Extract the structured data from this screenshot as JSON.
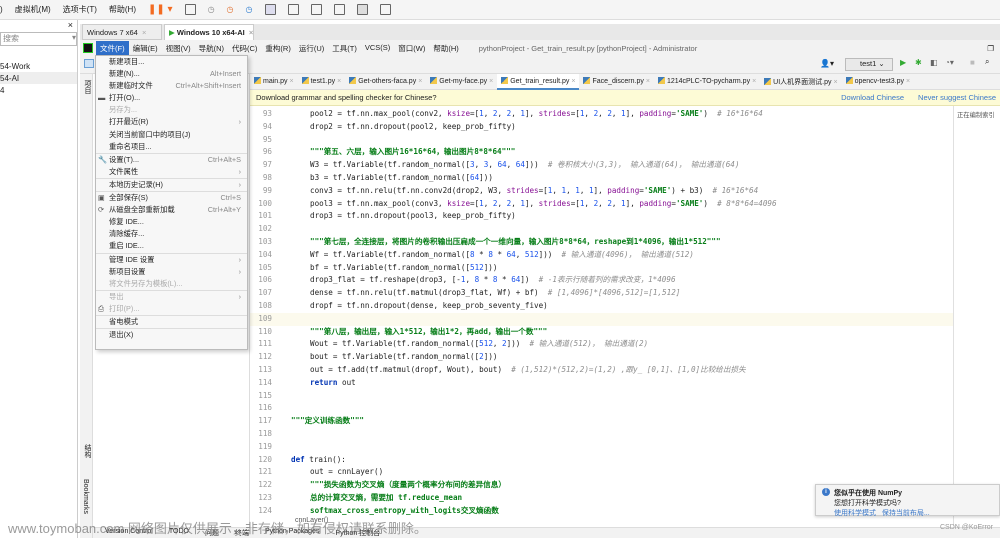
{
  "vmware": {
    "menu": [
      "虚拟机(M)",
      "选项卡(T)",
      "帮助(H)"
    ],
    "menu_lead": ")",
    "library": {
      "search_placeholder": "搜索",
      "items": [
        "54-Work",
        "54-AI",
        "4"
      ]
    },
    "vm_tabs": [
      {
        "label": "Windows 7 x64",
        "active": false
      },
      {
        "label": "Windows 10 x64-AI",
        "active": true
      }
    ]
  },
  "pycharm": {
    "menus": [
      "文件(F)",
      "编辑(E)",
      "视图(V)",
      "导航(N)",
      "代码(C)",
      "重构(R)",
      "运行(U)",
      "工具(T)",
      "VCS(S)",
      "窗口(W)",
      "帮助(H)"
    ],
    "window_title": "pythonProject - Get_train_result.py [pythonProject] - Administrator",
    "run_config": "test1",
    "tool_strip": [
      "项目",
      "结构",
      "Bookmarks"
    ],
    "tabs": [
      {
        "label": "main.py"
      },
      {
        "label": "test1.py"
      },
      {
        "label": "Get-others-faca.py"
      },
      {
        "label": "Get-my-face.py"
      },
      {
        "label": "Get_train_result.py",
        "active": true
      },
      {
        "label": "Face_discern.py"
      },
      {
        "label": "1214cPLC-TO-pycharm.py"
      },
      {
        "label": "UI人机界面测试.py"
      },
      {
        "label": "opencv-test3.py"
      }
    ],
    "banner": {
      "text": "Download grammar and spelling checker for Chinese?",
      "download": "Download Chinese",
      "never": "Never suggest Chinese"
    },
    "right_pane_text": "正在编制索引",
    "file_menu": [
      {
        "label": "新建项目..."
      },
      {
        "label": "新建(N)...",
        "shortcut": "Alt+Insert"
      },
      {
        "label": "新建临时文件",
        "shortcut": "Ctrl+Alt+Shift+Insert"
      },
      {
        "label": "打开(O)...",
        "icon": "folder"
      },
      {
        "label": "另存为...",
        "disabled": true
      },
      {
        "label": "打开最近(R)",
        "submenu": true
      },
      {
        "label": "关闭当前窗口中的项目(J)"
      },
      {
        "label": "重命名项目..."
      },
      {
        "sep": true
      },
      {
        "label": "设置(T)...",
        "shortcut": "Ctrl+Alt+S",
        "icon": "wrench"
      },
      {
        "label": "文件属性",
        "submenu": true
      },
      {
        "sep": true
      },
      {
        "label": "本地历史记录(H)",
        "submenu": true
      },
      {
        "sep": true
      },
      {
        "label": "全部保存(S)",
        "shortcut": "Ctrl+S",
        "icon": "save"
      },
      {
        "label": "从磁盘全部重新加载",
        "shortcut": "Ctrl+Alt+Y",
        "icon": "reload"
      },
      {
        "label": "修复 IDE..."
      },
      {
        "label": "清除缓存..."
      },
      {
        "label": "重启 IDE..."
      },
      {
        "sep": true
      },
      {
        "label": "管理 IDE 设置",
        "submenu": true
      },
      {
        "label": "新项目设置",
        "submenu": true
      },
      {
        "label": "将文件另存为模板(L)...",
        "disabled": true
      },
      {
        "sep": true
      },
      {
        "label": "导出",
        "submenu": true,
        "disabled": true
      },
      {
        "label": "打印(P)...",
        "icon": "print",
        "disabled": true
      },
      {
        "sep": true
      },
      {
        "label": "省电模式"
      },
      {
        "sep": true
      },
      {
        "label": "退出(X)"
      }
    ],
    "code": [
      {
        "n": 93,
        "i": 1,
        "t": "pool2 = tf.nn.max_pool(conv2, ksize=[1, 2, 2, 1], strides=[1, 2, 2, 1], padding='SAME')",
        "c": "# 16*16*64"
      },
      {
        "n": 94,
        "i": 1,
        "t": "drop2 = tf.nn.dropout(pool2, keep_prob_fifty)"
      },
      {
        "n": 95,
        "i": 0,
        "t": ""
      },
      {
        "n": 96,
        "i": 1,
        "t": "\"\"\"第五、六层，输入图片16*16*64，输出图片8*8*64\"\"\"",
        "doc": true
      },
      {
        "n": 97,
        "i": 1,
        "t": "W3 = tf.Variable(tf.random_normal([3, 3, 64, 64]))",
        "c": "# 卷积核大小(3,3)， 输入通道(64)， 输出通道(64)"
      },
      {
        "n": 98,
        "i": 1,
        "t": "b3 = tf.Variable(tf.random_normal([64]))"
      },
      {
        "n": 99,
        "i": 1,
        "t": "conv3 = tf.nn.relu(tf.nn.conv2d(drop2, W3, strides=[1, 1, 1, 1], padding='SAME') + b3)",
        "c": "# 16*16*64"
      },
      {
        "n": 100,
        "i": 1,
        "t": "pool3 = tf.nn.max_pool(conv3, ksize=[1, 2, 2, 1], strides=[1, 2, 2, 1], padding='SAME')",
        "c": "# 8*8*64=4096"
      },
      {
        "n": 101,
        "i": 1,
        "t": "drop3 = tf.nn.dropout(pool3, keep_prob_fifty)"
      },
      {
        "n": 102,
        "i": 0,
        "t": ""
      },
      {
        "n": 103,
        "i": 1,
        "t": "\"\"\"第七层，全连接层，将图片的卷积输出压扁成一个一维向量，输入图片8*8*64，reshape到1*4096，输出1*512\"\"\"",
        "doc": true
      },
      {
        "n": 104,
        "i": 1,
        "t": "Wf = tf.Variable(tf.random_normal([8 * 8 * 64, 512]))",
        "c": "# 输入通道(4096)， 输出通道(512)"
      },
      {
        "n": 105,
        "i": 1,
        "t": "bf = tf.Variable(tf.random_normal([512]))"
      },
      {
        "n": 106,
        "i": 1,
        "t": "drop3_flat = tf.reshape(drop3, [-1, 8 * 8 * 64])",
        "c": "# -1表示行随着列的需求改变，1*4096"
      },
      {
        "n": 107,
        "i": 1,
        "t": "dense = tf.nn.relu(tf.matmul(drop3_flat, Wf) + bf)",
        "c": "# [1,4096]*[4096,512]=[1,512]"
      },
      {
        "n": 108,
        "i": 1,
        "t": "dropf = tf.nn.dropout(dense, keep_prob_seventy_five)"
      },
      {
        "n": 109,
        "i": 0,
        "t": "",
        "current": true
      },
      {
        "n": 110,
        "i": 1,
        "t": "\"\"\"第八层，输出层，输入1*512，输出1*2，再add，输出一个数\"\"\"",
        "doc": true
      },
      {
        "n": 111,
        "i": 1,
        "t": "Wout = tf.Variable(tf.random_normal([512, 2]))",
        "c": "# 输入通道(512)， 输出通道(2)"
      },
      {
        "n": 112,
        "i": 1,
        "t": "bout = tf.Variable(tf.random_normal([2]))"
      },
      {
        "n": 113,
        "i": 1,
        "t": "out = tf.add(tf.matmul(dropf, Wout), bout)",
        "c": "# (1,512)*(512,2)=(1,2) ,跟y_ [0,1]、[1,0]比较给出损失"
      },
      {
        "n": 114,
        "i": 1,
        "t": "return out"
      },
      {
        "n": 115,
        "i": 0,
        "t": ""
      },
      {
        "n": 116,
        "i": 0,
        "t": ""
      },
      {
        "n": 117,
        "i": 0,
        "t": "\"\"\"定义训练函数\"\"\"",
        "doc": true
      },
      {
        "n": 118,
        "i": 0,
        "t": ""
      },
      {
        "n": 119,
        "i": 0,
        "t": ""
      },
      {
        "n": 120,
        "i": 0,
        "t": "def train():"
      },
      {
        "n": 121,
        "i": 1,
        "t": "out = cnnLayer()"
      },
      {
        "n": 122,
        "i": 1,
        "t": "\"\"\"损失函数为交叉熵（度量两个概率分布间的差异信息）",
        "doc": true
      },
      {
        "n": 123,
        "i": 1,
        "t": "总的计算交叉熵，需要加 tf.reduce_mean",
        "doc": true
      },
      {
        "n": 124,
        "i": 1,
        "t": "softmax_cross_entropy_with_logits交叉熵函数",
        "doc": true
      }
    ],
    "breadcrumb_hint": "cnnLayer()",
    "bottom_tools": [
      "Version Control",
      "TODO",
      "问题",
      "终端",
      "Python Packages",
      "Python 控制台"
    ],
    "notification": {
      "title": "您似乎在使用 NumPy",
      "body": "您想打开科学模式吗?",
      "action1": "使用科学模式",
      "action2": "保持当前布局..."
    }
  },
  "watermark": "www.toymoban.com 网络图片仅供展示，非存储，如有侵权请联系删除。",
  "credit": "CSDN @KoError",
  "colors": {
    "accent": "#2f6fc9",
    "banner": "#fdfbd6",
    "string": "#067d17",
    "number": "#1750eb"
  }
}
